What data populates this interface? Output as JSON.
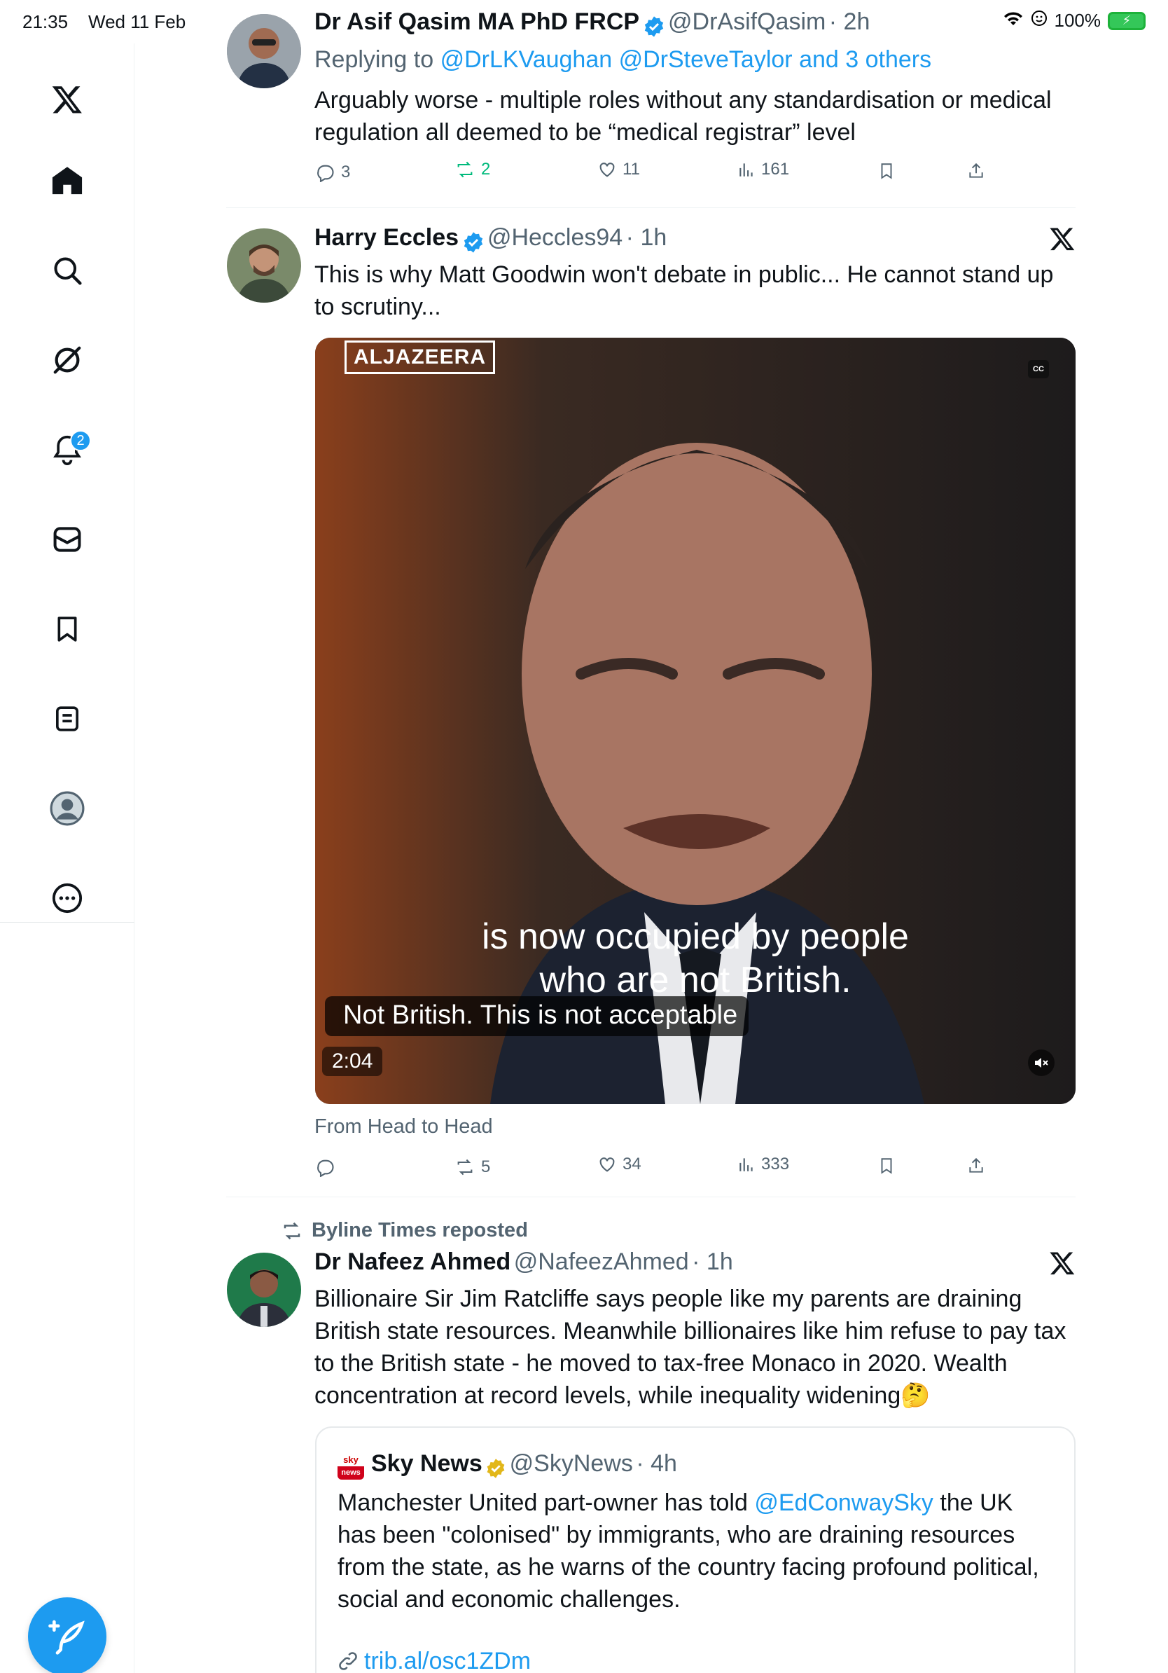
{
  "status_bar": {
    "time": "21:35",
    "date": "Wed 11 Feb",
    "battery": "100%"
  },
  "sidebar": {
    "notifications_badge": "2",
    "items": [
      "x-logo",
      "home",
      "search",
      "grok",
      "notifications",
      "messages",
      "bookmarks",
      "lists",
      "profile",
      "more"
    ]
  },
  "tweets": [
    {
      "name": "Dr Asif Qasim MA PhD FRCP",
      "handle": "@DrAsifQasim",
      "time": "· 2h",
      "replying_prefix": "Replying to",
      "replying_to": "@DrLKVaughan @DrSteveTaylor and 3 others",
      "line1": "Arguably worse - multiple roles without any standardisation or medical",
      "line2": "regulation all deemed to be “medical registrar” level",
      "replies": "3",
      "reposts": "2",
      "likes": "11",
      "views": "161"
    },
    {
      "name": "Harry Eccles",
      "handle": "@Heccles94",
      "time": "· 1h",
      "line1": "This is why Matt Goodwin won't debate in public... He cannot stand up",
      "line2": "to scrutiny...",
      "video": {
        "logo": "ALJAZEERA",
        "cc": "CC",
        "caption_line1": "is now occupied by people",
        "caption_line2": "who are not British.",
        "subtitle": "Not British. This is not acceptable",
        "duration": "2:04"
      },
      "source": "From Head to Head",
      "replies": "",
      "reposts": "5",
      "likes": "34",
      "views": "333"
    },
    {
      "reposted_by": "Byline Times reposted",
      "name": "Dr Nafeez Ahmed",
      "handle": "@NafeezAhmed",
      "time": "· 1h",
      "line1": "Billionaire Sir Jim Ratcliffe says people like my parents are draining",
      "line2": "British state resources. Meanwhile billionaires like him refuse to pay tax",
      "line3": "to the British state - he moved to tax-free Monaco in 2020. Wealth",
      "line4": "concentration at record levels, while inequality widening",
      "emoji": "🤔",
      "quote": {
        "name": "Sky News",
        "handle": "@SkyNews",
        "time": "· 4h",
        "logo_top": "sky",
        "logo_bottom": "news",
        "line1_prefix": "Manchester United part-owner has told ",
        "line1_mention": "@EdConwaySky",
        "line1_suffix": " the UK",
        "line2": "has been \"colonised\" by immigrants, who are draining resources",
        "line3": "from the state, as he warns of the country facing profound political,",
        "line4": "social and economic challenges.",
        "link": "trib.al/osc1ZDm"
      }
    }
  ],
  "colors": {
    "accent": "#1d9bf0",
    "repost_green": "#00ba7c",
    "text_secondary": "#536471"
  }
}
